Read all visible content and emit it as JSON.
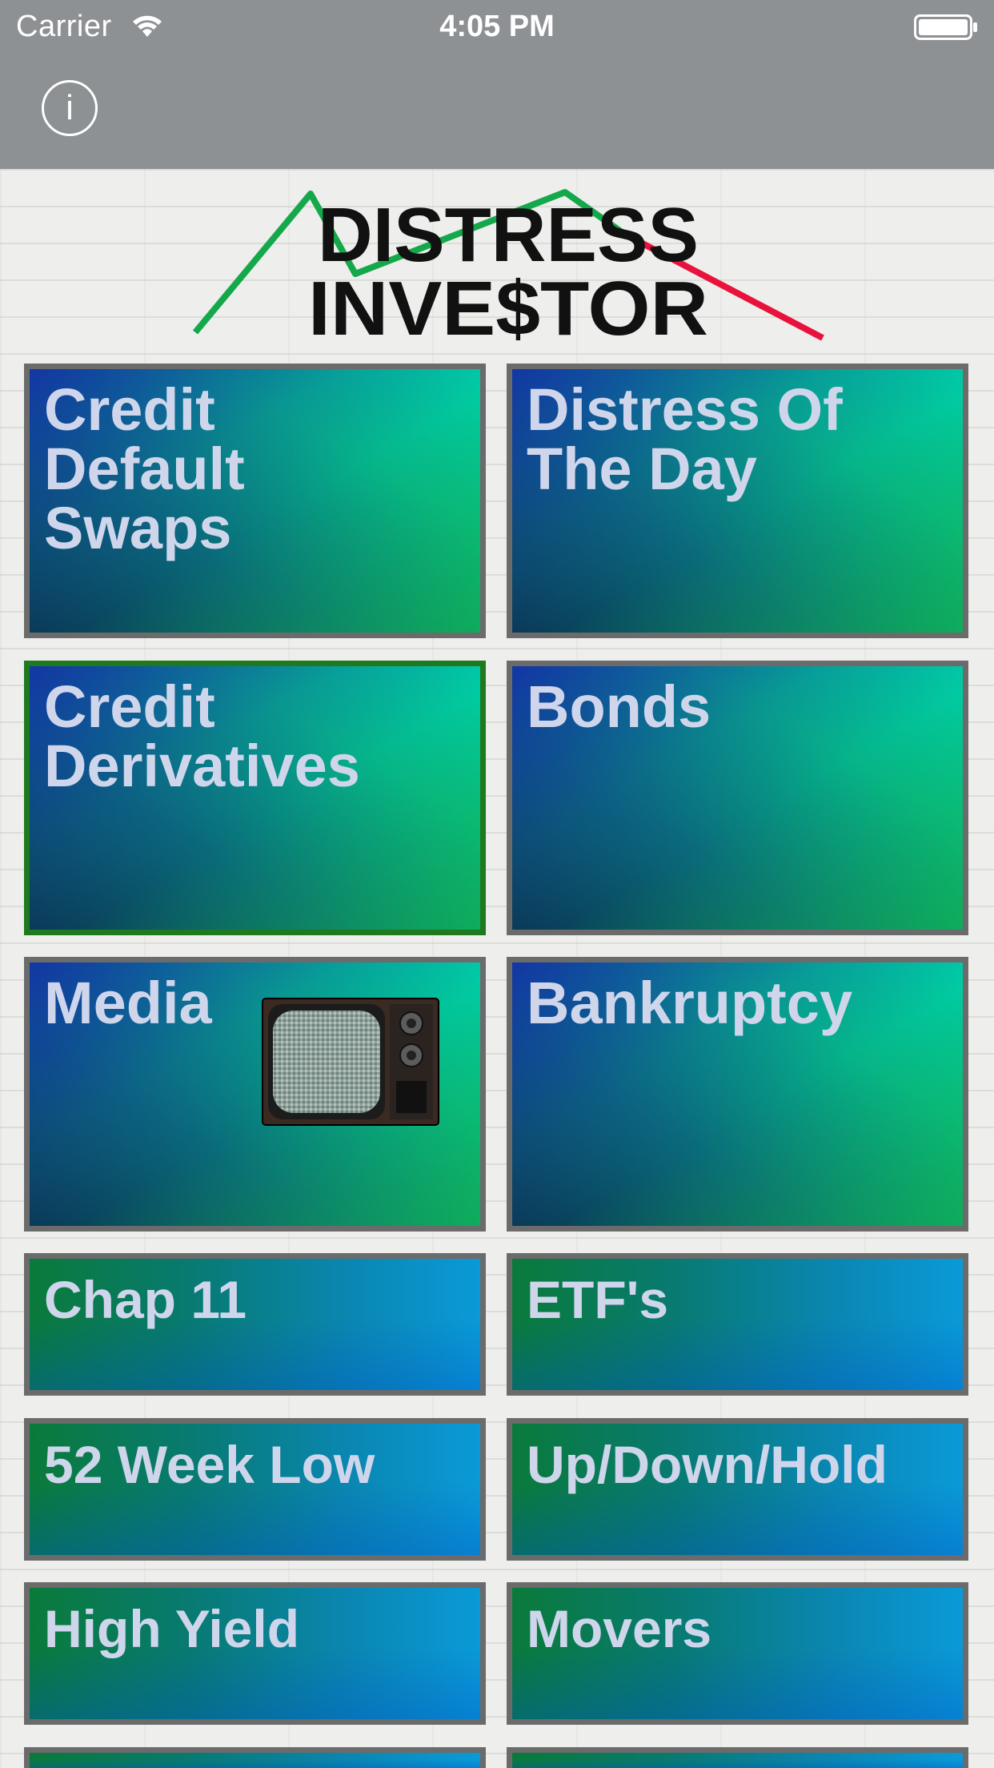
{
  "status_bar": {
    "carrier": "Carrier",
    "time": "4:05 PM",
    "wifi_icon": "wifi-icon",
    "battery_icon": "battery-icon"
  },
  "nav_bar": {
    "info_label": "i",
    "info_icon": "info-icon"
  },
  "logo": {
    "line1": "DISTRESS",
    "line2": "INVE$TOR",
    "colors": {
      "up_line": "#14a84b",
      "down_line": "#e8123c"
    }
  },
  "tiles": [
    {
      "label": "Credit\nDefault\nSwaps",
      "style": "big"
    },
    {
      "label": "Distress Of\nThe Day",
      "style": "big"
    },
    {
      "label": "Credit\nDerivatives",
      "style": "big",
      "selected": true
    },
    {
      "label": "Bonds",
      "style": "big"
    },
    {
      "label": "Media",
      "style": "big",
      "icon": "tv-icon"
    },
    {
      "label": "Bankruptcy",
      "style": "big"
    },
    {
      "label": "Chap 11",
      "style": "small"
    },
    {
      "label": "ETF's",
      "style": "small"
    },
    {
      "label": "52 Week Low",
      "style": "small"
    },
    {
      "label": "Up/Down/Hold",
      "style": "small"
    },
    {
      "label": "High Yield",
      "style": "small"
    },
    {
      "label": "Movers",
      "style": "small"
    }
  ],
  "colors": {
    "bar_background": "#8d9194",
    "tile_border": "#6b6b6b",
    "tile_text": "#cfd6ec",
    "selected_border": "#1f7a1f"
  }
}
